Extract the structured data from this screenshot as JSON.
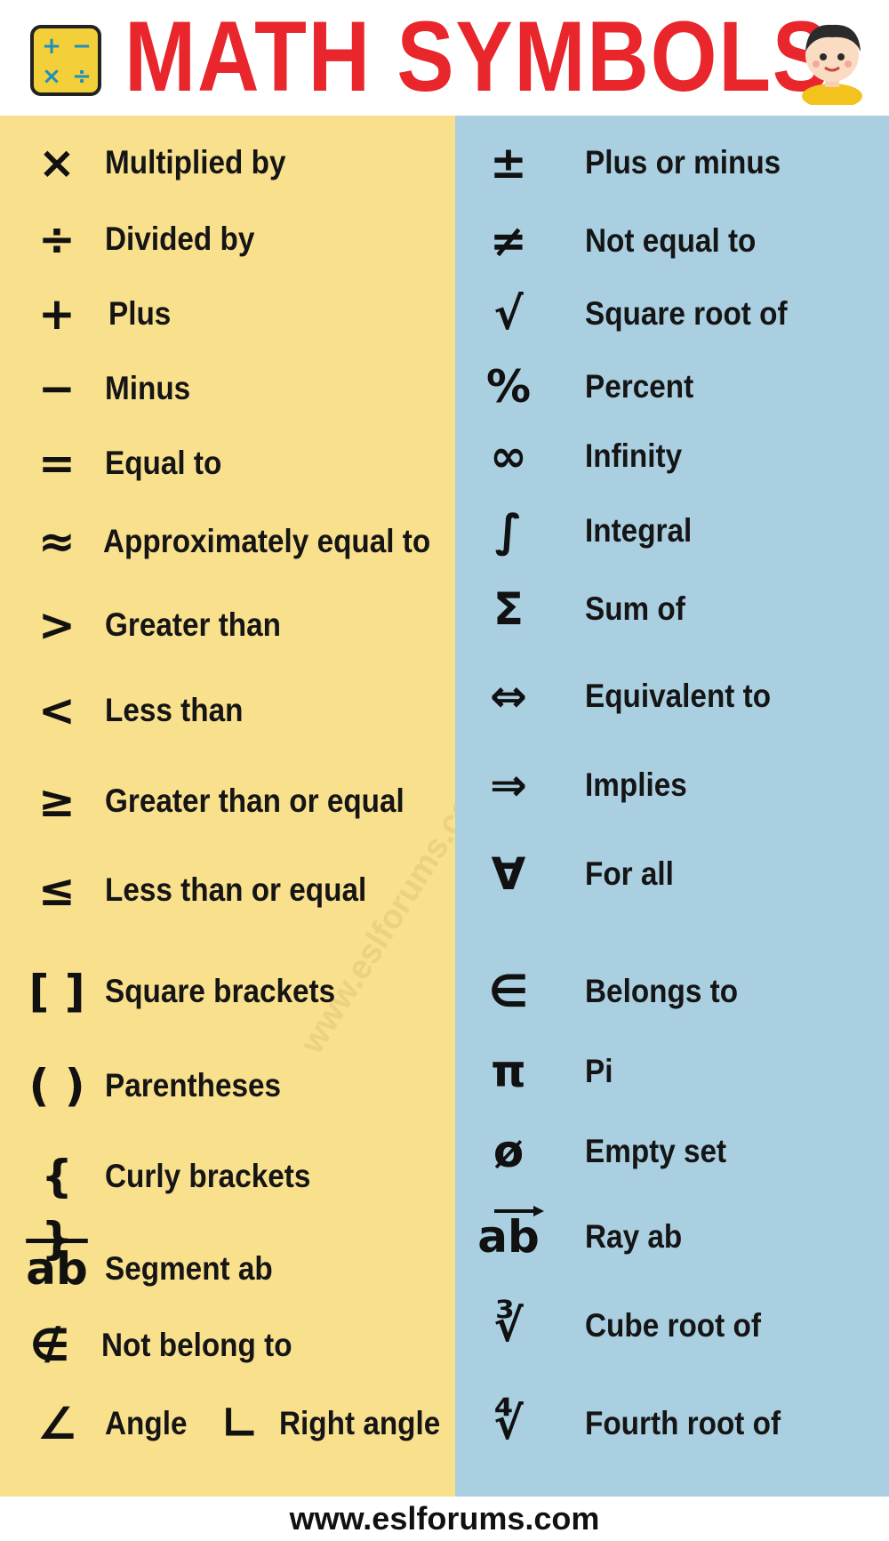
{
  "header": {
    "title": "MATH SYMBOLS",
    "icon_cells": [
      "+",
      "−",
      "×",
      "÷"
    ]
  },
  "colors": {
    "title": "#e8262b",
    "left_bg": "#f9e08c",
    "right_bg": "#a9cfe0",
    "text": "#151515"
  },
  "watermark": "www.eslforums.com",
  "left": [
    {
      "symbol": "×",
      "label": "Multiplied by"
    },
    {
      "symbol": "÷",
      "label": "Divided by"
    },
    {
      "symbol": "+",
      "label": "Plus"
    },
    {
      "symbol": "−",
      "label": "Minus"
    },
    {
      "symbol": "=",
      "label": "Equal to"
    },
    {
      "symbol": "≈",
      "label": "Approximately equal to"
    },
    {
      "symbol": ">",
      "label": "Greater than"
    },
    {
      "symbol": "<",
      "label": "Less than"
    },
    {
      "symbol": "≥",
      "label": "Greater than or equal"
    },
    {
      "symbol": "≤",
      "label": "Less than or equal"
    },
    {
      "symbol": "[ ]",
      "label": "Square brackets"
    },
    {
      "symbol": "( )",
      "label": "Parentheses"
    },
    {
      "symbol": "{ }",
      "label": "Curly brackets"
    },
    {
      "symbol": "ab",
      "label": "Segment ab"
    },
    {
      "symbol": "∉",
      "label": "Not belong to"
    },
    {
      "symbol": "∠",
      "label": "Angle"
    },
    {
      "symbol": "∟",
      "label": "Right angle"
    }
  ],
  "right": [
    {
      "symbol": "±",
      "label": "Plus or minus"
    },
    {
      "symbol": "≠",
      "label": "Not equal to"
    },
    {
      "symbol": "√",
      "label": "Square root of"
    },
    {
      "symbol": "%",
      "label": "Percent"
    },
    {
      "symbol": "∞",
      "label": "Infinity"
    },
    {
      "symbol": "∫",
      "label": "Integral"
    },
    {
      "symbol": "Σ",
      "label": "Sum of"
    },
    {
      "symbol": "⇔",
      "label": "Equivalent to"
    },
    {
      "symbol": "⇒",
      "label": "Implies"
    },
    {
      "symbol": "∀",
      "label": "For all"
    },
    {
      "symbol": "∈",
      "label": "Belongs to"
    },
    {
      "symbol": "π",
      "label": "Pi"
    },
    {
      "symbol": "ø",
      "label": "Empty set"
    },
    {
      "symbol": "ab",
      "label": "Ray ab"
    },
    {
      "symbol": "∛",
      "label": "Cube root of"
    },
    {
      "symbol": "∜",
      "label": "Fourth root of"
    }
  ],
  "footer": "www.eslforums.com"
}
